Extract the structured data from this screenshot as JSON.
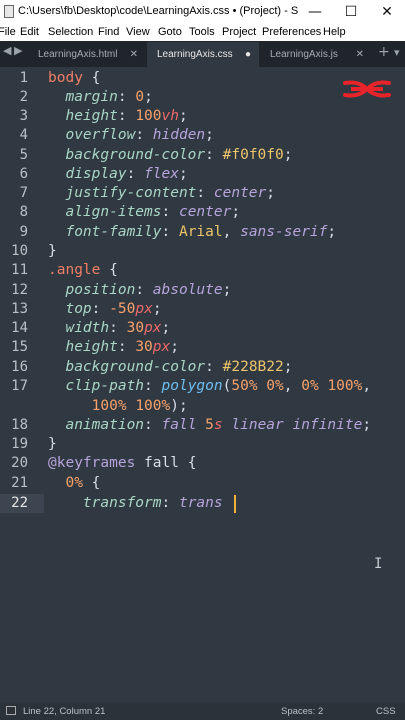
{
  "window": {
    "title": "C:\\Users\\fb\\Desktop\\code\\LearningAxis.css • (Project) - Subl...",
    "minimize_glyph": "—",
    "maximize_glyph": "☐",
    "close_glyph": "✕"
  },
  "menu": [
    "File",
    "Edit",
    "Selection",
    "Find",
    "View",
    "Goto",
    "Tools",
    "Project",
    "Preferences",
    "Help"
  ],
  "tabs": [
    {
      "label": "LearningAxis.html",
      "control": "✕"
    },
    {
      "label": "LearningAxis.css",
      "control": "●"
    },
    {
      "label": "LearningAxis.js",
      "control": "✕"
    }
  ],
  "tabbar": {
    "add_glyph": "+",
    "more_glyph": "▾",
    "back_glyph": "◀",
    "forward_glyph": "▶"
  },
  "code": {
    "line_numbers": [
      "1",
      "2",
      "3",
      "4",
      "5",
      "6",
      "7",
      "8",
      "9",
      "10",
      "11",
      "12",
      "13",
      "14",
      "15",
      "16",
      "17",
      "",
      "18",
      "19",
      "20",
      "21",
      "22"
    ],
    "current_line": "22"
  },
  "statusbar": {
    "position": "Line 22, Column 21",
    "spaces": "Spaces: 2",
    "syntax": "CSS"
  },
  "colors": {
    "editor_bg": "#303841",
    "selector": "#ee7f66",
    "property": "#a9d6c5",
    "cursor": "#f2b23a"
  }
}
